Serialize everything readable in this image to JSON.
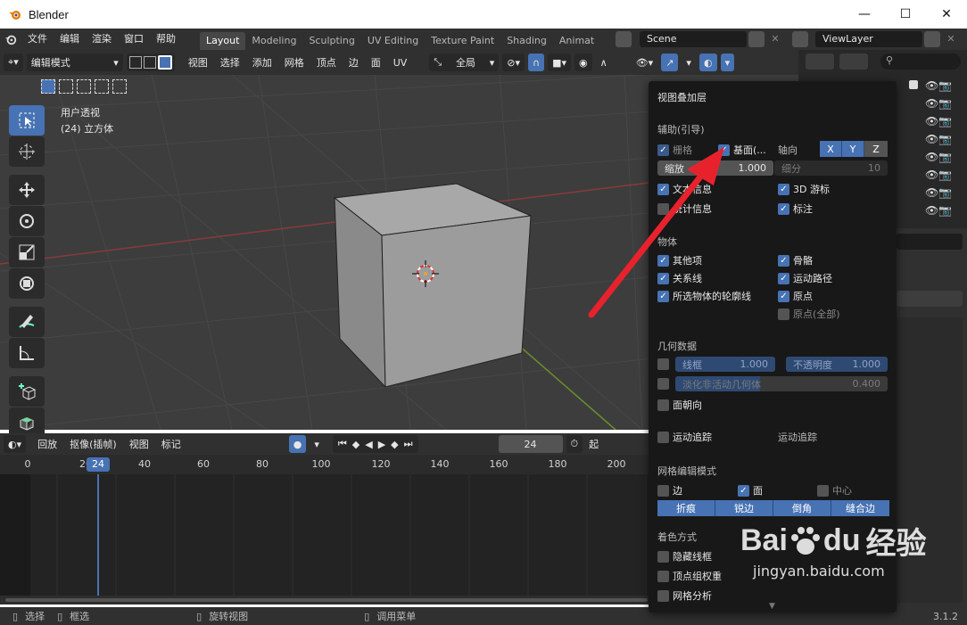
{
  "window": {
    "title": "Blender",
    "minimize": "—",
    "maximize": "☐",
    "close": "✕"
  },
  "topmenu": {
    "items": [
      "文件",
      "编辑",
      "渲染",
      "窗口",
      "帮助"
    ],
    "workspaces": [
      "Layout",
      "Modeling",
      "Sculpting",
      "UV Editing",
      "Texture Paint",
      "Shading",
      "Animat"
    ],
    "scene": "Scene",
    "view_layer": "ViewLayer"
  },
  "viewport_header": {
    "mode": "编辑模式",
    "menus": [
      "视图",
      "选择",
      "添加",
      "网格",
      "顶点",
      "边",
      "面",
      "UV"
    ],
    "transform_orientation": "全局"
  },
  "viewport": {
    "view_name": "用户透视",
    "object_info": "(24) 立方体"
  },
  "timeline": {
    "menus": [
      "回放",
      "抠像(插帧)",
      "视图",
      "标记"
    ],
    "current_frame": "24",
    "start_label": "起",
    "ticks": [
      "0",
      "20",
      "40",
      "60",
      "80",
      "100",
      "120",
      "140",
      "160",
      "180",
      "200"
    ],
    "playhead": "24"
  },
  "statusbar": {
    "items": [
      "选择",
      "框选",
      "旋转视图",
      "调用菜单"
    ],
    "version": "3.1.2"
  },
  "overlay": {
    "title": "视图叠加层",
    "guides_section": "辅助(引导)",
    "grid": {
      "label": "栅格",
      "checked": true
    },
    "floor": {
      "label": "基面(...",
      "checked": true
    },
    "axes_label": "轴向",
    "axes": [
      "X",
      "Y",
      "Z"
    ],
    "scale": {
      "label": "缩放",
      "value": "1.000"
    },
    "subdivisions": {
      "label": "细分",
      "value": "10"
    },
    "text_info": {
      "label": "文本信息",
      "checked": true
    },
    "cursor_3d": {
      "label": "3D 游标",
      "checked": true
    },
    "stats": {
      "label": "统计信息",
      "checked": false
    },
    "annotations": {
      "label": "标注",
      "checked": true
    },
    "objects_section": "物体",
    "extras": {
      "label": "其他项",
      "checked": true
    },
    "bones": {
      "label": "骨骼",
      "checked": true
    },
    "relationship_lines": {
      "label": "关系线",
      "checked": true
    },
    "motion_paths": {
      "label": "运动路径",
      "checked": true
    },
    "outline_selected": {
      "label": "所选物体的轮廓线",
      "checked": true
    },
    "origins": {
      "label": "原点",
      "checked": true
    },
    "origins_all": {
      "label": "原点(全部)",
      "checked": false
    },
    "geometry_section": "几何数据",
    "wireframe": {
      "label": "线框",
      "value": "1.000"
    },
    "opacity": {
      "label": "不透明度",
      "value": "1.000"
    },
    "fade_inactive": {
      "label": "淡化非活动几何体",
      "value": "0.400"
    },
    "face_orientation": {
      "label": "面朝向",
      "checked": false
    },
    "motion_tracking": {
      "label": "运动追踪",
      "checked": false,
      "right_label": "运动追踪"
    },
    "mesh_edit_section": "网格编辑模式",
    "edges": {
      "label": "边",
      "checked": false
    },
    "faces": {
      "label": "面",
      "checked": true
    },
    "center": {
      "label": "中心",
      "checked": false
    },
    "edge_marks": [
      "折痕",
      "锐边",
      "倒角",
      "缝合边"
    ],
    "shading_section": "着色方式",
    "hidden_wire": {
      "label": "隐藏线框",
      "checked": false
    },
    "vertex_group_weights": {
      "label": "顶点组权重",
      "checked": false
    },
    "mesh_analysis": {
      "label": "网格分析",
      "checked": false
    }
  },
  "watermark": {
    "brand": "Bai",
    "brand2": "du",
    "cn": "经验",
    "url": "jingyan.baidu.com"
  },
  "colors": {
    "accent": "#4772b3",
    "arrow": "#e8222c"
  }
}
